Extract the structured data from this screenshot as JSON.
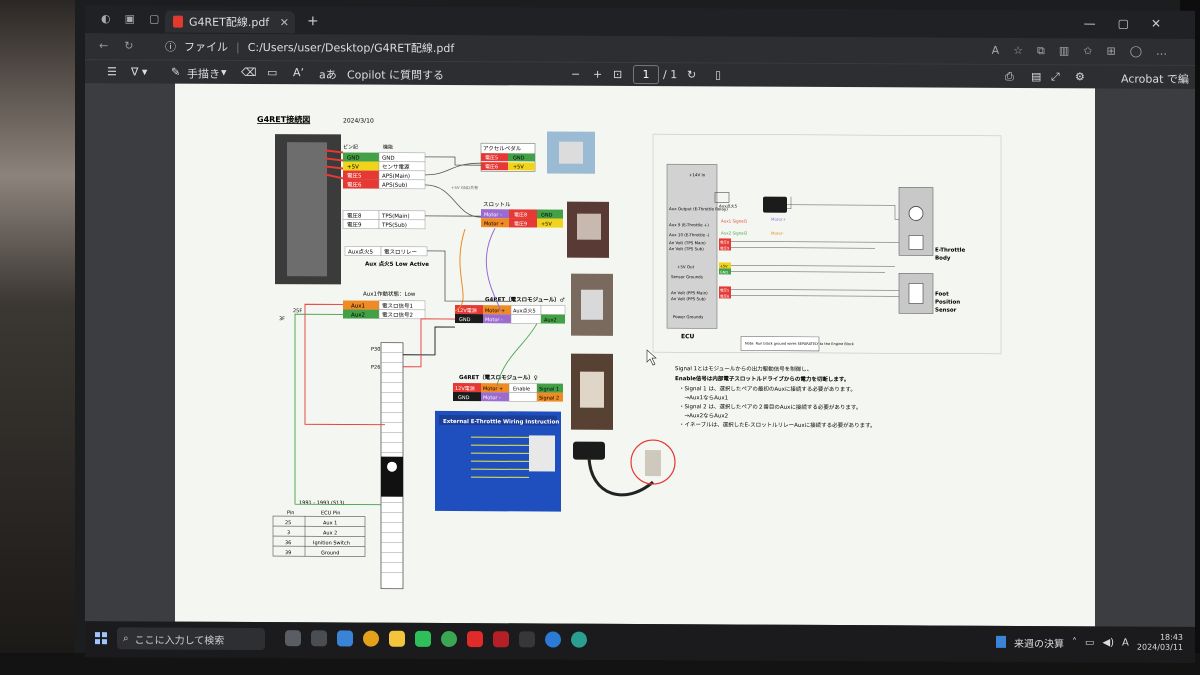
{
  "browser": {
    "tab_title": "G4RET配線.pdf",
    "address_prefix": "ファイル",
    "address_path": "C:/Users/user/Desktop/G4RET配線.pdf"
  },
  "toolbar": {
    "draw_label": "手描き",
    "copilot_label": "Copilot に質問する",
    "page_current": "1",
    "page_total": "/ 1",
    "acrobat_label": "Acrobat で編集"
  },
  "document": {
    "title": "G4RET接続図",
    "date": "2024/3/10",
    "left_header": "ピン記",
    "left_header2": "機能",
    "rows_top": [
      {
        "a": "GND",
        "b": "GND"
      },
      {
        "a": "+5V",
        "b": "センサ電源"
      },
      {
        "a": "電圧5",
        "b": "APS(Main)"
      },
      {
        "a": "電圧6",
        "b": "APS(Sub)"
      }
    ],
    "rows_tps": [
      {
        "a": "電圧8",
        "b": "TPS(Main)"
      },
      {
        "a": "電圧9",
        "b": "TPS(Sub)"
      }
    ],
    "aux_relay": {
      "a": "Aux点火5",
      "b": "電スロリレー"
    },
    "aux_low_active": "Aux 点火5 Low Active",
    "aux1_state": "Aux1作動状態：Low",
    "aux_rows": [
      {
        "a": "Aux1",
        "b": "電スロ信号1"
      },
      {
        "a": "Aux2",
        "b": "電スロ信号2"
      }
    ],
    "pin_25f": "25F",
    "pin_3f": "3F",
    "pin_p30": "P30",
    "pin_p26": "P26",
    "accel_box": {
      "title": "アクセルペダル",
      "r1a": "電圧5",
      "r1b": "GND",
      "r2a": "電圧6",
      "r2b": "+5V"
    },
    "throttle_box": {
      "title": "スロットル",
      "r1a": "Motor -",
      "r1b": "電圧8",
      "r1c": "GND",
      "r2a": "Motor +",
      "r2b": "電圧9",
      "r2c": "+5V"
    },
    "module_male": {
      "title": "G4RET（電スロモジュール）♂",
      "r1a": "12V電源",
      "r1b": "Motor +",
      "r1c": "Aux点火5",
      "r2a": "GND",
      "r2b": "Motor -",
      "r2c": "Aux2"
    },
    "module_female": {
      "title": "G4RET（電スロモジュール）♀",
      "r1a": "12V電源",
      "r1b": "Motor +",
      "r1c": "Enable",
      "r1d": "Signal 1",
      "r2a": "GND",
      "r2b": "Motor -",
      "r2d": "Signal 2"
    },
    "small_note": "+5V  GND共有",
    "wiring_card_title": "External E-Throttle Wiring Instruction",
    "ecu_table": {
      "title": "1991 - 1993 (S13)",
      "headers": [
        "Pin",
        "ECU Pin"
      ],
      "rows": [
        [
          "25",
          "Aux 1"
        ],
        [
          "3",
          "Aux 2"
        ],
        [
          "36",
          "Ignition Switch"
        ],
        [
          "39",
          "Ground"
        ]
      ]
    },
    "ecu_diagram": {
      "plus14v": "+14V In",
      "aux_output": "Aux Output (E-Throttle Relay)",
      "aux_ign5": "Aux点火5",
      "aux9": "Aux 9 (E-Throttle +)",
      "aux10": "Aux 10 (E-Throttle -)",
      "an_volt_tps_main": "An Volt (TPS Main)",
      "an_volt_tps_sub": "An Volt (TPS Sub)",
      "plus5v_out": "+5V Out",
      "sensor_grounds": "Sensor Grounds",
      "an_volt_pps_main": "An Volt (PPS Main)",
      "an_volt_pps_sub": "An Volt (PPS Sub)",
      "power_grounds": "Power Grounds",
      "ecu_label": "ECU",
      "aux1_signal1": "Aux1 Signal1",
      "aux2_signal2": "Aux2 Signal2",
      "motor_plus": "Motor+",
      "motor_minus": "Motor-",
      "v8": "電圧8",
      "v9": "電圧9",
      "plus5v": "+5V",
      "gnd": "GND",
      "v5": "電圧5",
      "v6": "電圧6",
      "etb_label_1": "E-Throttle",
      "etb_label_2": "Body",
      "fps_label_1": "Foot",
      "fps_label_2": "Position",
      "fps_label_3": "Sensor",
      "note": "Note: Run black ground wires SEPARATELY to the Engine Block"
    },
    "notes": [
      "Signal 1とはモジュールからの出力駆動信号を制御し、",
      "Enable信号は内部電子スロットルドライブからの電力を切断します。",
      "・Signal 1 は、選択したペアの最初のAuxに接続する必要があります。",
      "　→Aux1ならAux1",
      "・Signal 2 は、選択したペアの２番目のAuxに接続する必要があります。",
      "　→Aux2ならAux2",
      "・イネーブルは、選択したE-スロットルリレーAuxに接続する必要があります。"
    ]
  },
  "taskbar": {
    "search_placeholder": "ここに入力して検索",
    "weather": "来週の決算",
    "time": "18:43",
    "date": "2024/03/11",
    "ime": "A"
  },
  "colors": {
    "red": "#e53935",
    "green": "#43a047",
    "yellow": "#f2d31b",
    "purple": "#9b6bd0",
    "orange": "#f08a24",
    "black": "#1b1b1b"
  }
}
